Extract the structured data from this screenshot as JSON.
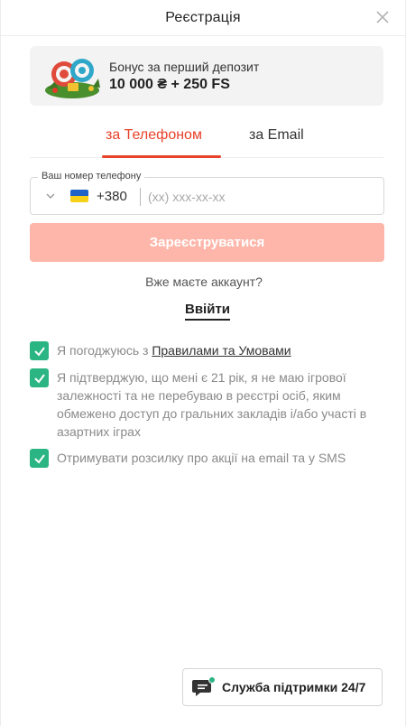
{
  "header": {
    "title": "Реєстрація"
  },
  "bonus": {
    "line1": "Бонус за перший депозит",
    "line2": "10 000 ₴ + 250 FS"
  },
  "tabs": [
    {
      "label": "за Телефоном",
      "active": true
    },
    {
      "label": "за Email",
      "active": false
    }
  ],
  "phone": {
    "label": "Ваш номер телефону",
    "country_code": "+380",
    "value": "",
    "placeholder": "(xx) xxx-xx-xx"
  },
  "register_button": "Зареєструватися",
  "have_account": "Вже маєте аккаунт?",
  "login_link": "Ввійти",
  "checkboxes": [
    {
      "text_prefix": "Я погоджуюсь з ",
      "link": "Правилами та Умовами",
      "checked": true
    },
    {
      "text": "Я підтверджую, що мені є 21 рік, я не маю ігрової залежності та не перебуваю в реєстрі осіб, яким обмежено доступ до гральних закладів і/або участі в азартних іграх",
      "checked": true
    },
    {
      "text": "Отримувати розсилку про акції на email та у SMS",
      "checked": true
    }
  ],
  "support_button": "Служба підтримки 24/7",
  "colors": {
    "accent": "#e8412a",
    "button_disabled": "#feb6aa",
    "checkbox": "#2bb583",
    "online_dot": "#2bb583"
  },
  "icons": [
    "close-icon",
    "chevron-down-icon",
    "ukraine-flag-icon",
    "check-icon",
    "chat-icon"
  ]
}
